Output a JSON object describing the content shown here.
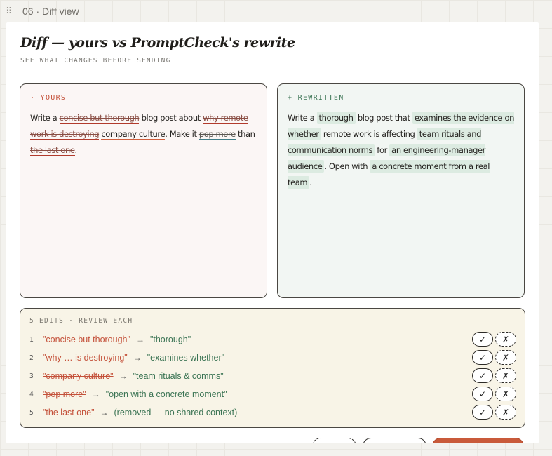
{
  "topbar": {
    "title": "06 · Diff view"
  },
  "card": {
    "title": "Diff — yours vs PromptCheck's rewrite",
    "subtitle": "SEE WHAT CHANGES BEFORE SENDING"
  },
  "yours": {
    "label": "· YOURS",
    "t1": "Write a ",
    "d1": "concise but thorough",
    "t2": " blog post about ",
    "d2": "why remote work is destroying",
    "t3": " ",
    "c1": "company culture",
    "t4": ". Make it ",
    "d3": "pop more",
    "t5": " than ",
    "d4": "the last one",
    "t6": "."
  },
  "rewritten": {
    "label": "+ REWRITTEN",
    "t1": "Write a ",
    "i1": "thorough",
    "t2": " blog post that ",
    "i2": "examines the evidence on whether",
    "t3": " remote work is affecting ",
    "i3": "team rituals and communication norms",
    "t4": " for ",
    "i4": "an engineering-manager audience",
    "t5": ". Open with ",
    "i5": "a concrete moment from a real team",
    "t6": "."
  },
  "edits": {
    "label": "5 EDITS · REVIEW EACH",
    "arrow": "→",
    "accept_icon": "✓",
    "reject_icon": "✗",
    "items": [
      {
        "num": "1",
        "old": "\"concise but thorough\"",
        "new": "\"thorough\""
      },
      {
        "num": "2",
        "old": "\"why … is destroying\"",
        "new": "\"examines whether\""
      },
      {
        "num": "3",
        "old": "\"company culture\"",
        "new": "\"team rituals & comms\""
      },
      {
        "num": "4",
        "old": "\"pop more\"",
        "new": "\"open with a concrete moment\""
      },
      {
        "num": "5",
        "old": "\"the last one\"",
        "new": "(removed — no shared context)"
      }
    ]
  },
  "colors": {
    "accent": "#c95a3a",
    "insert": "#3a7353",
    "delete": "#c4513a"
  }
}
